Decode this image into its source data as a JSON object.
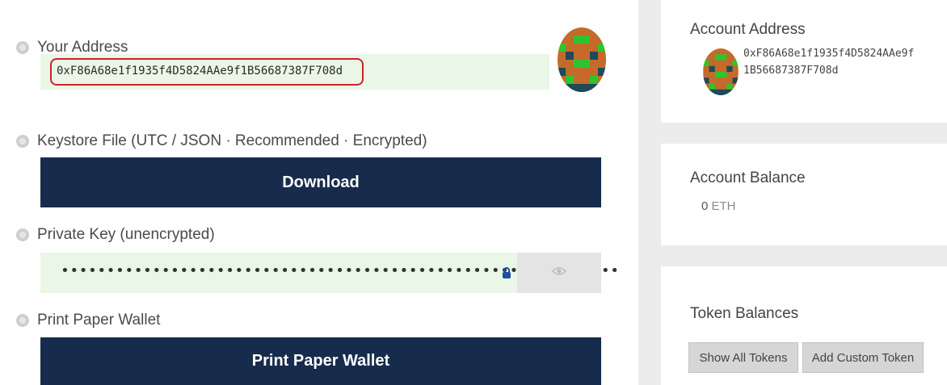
{
  "wallet": {
    "your_address_label": "Your Address",
    "address_value": "0xF86A68e1f1935f4D5824AAe9f1B56687387F708d",
    "keystore_label": "Keystore File (UTC / JSON · Recommended · Encrypted)",
    "download_label": "Download",
    "private_key_label": "Private Key (unencrypted)",
    "private_key_masked": "•••••••••••••••••••••••••••••••••••••••••••••••••••••••••••••",
    "print_label": "Print Paper Wallet",
    "print_button": "Print Paper Wallet"
  },
  "sidebar": {
    "account_address_title": "Account Address",
    "account_address_line1": "0xF86A68e1f1935f4D5824AAe9f",
    "account_address_line2": "1B56687387F708d",
    "account_balance_title": "Account Balance",
    "balance_value": "0",
    "balance_unit": "ETH",
    "token_balances_title": "Token Balances",
    "show_all_tokens": "Show All Tokens",
    "add_custom_token": "Add Custom Token"
  },
  "colors": {
    "primary_button": "#172b4d",
    "address_highlight": "#d0202a",
    "field_background": "#eaf6e6"
  },
  "icons": [
    "info-icon",
    "identicon",
    "lock-icon",
    "eye-icon"
  ]
}
